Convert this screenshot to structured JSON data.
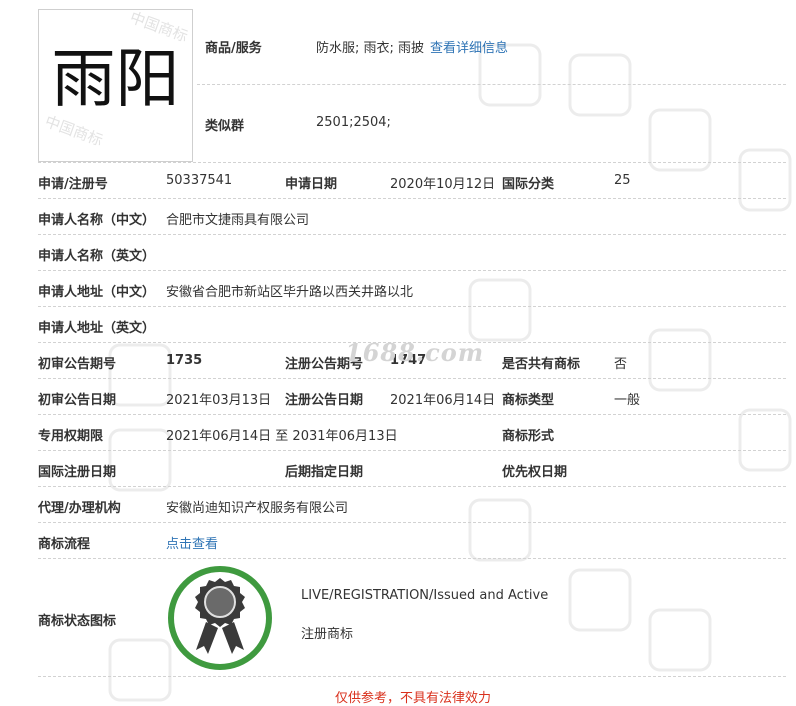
{
  "trademark": {
    "name": "雨阳",
    "goods_label": "商品/服务",
    "goods_value": "防水服; 雨衣; 雨披",
    "goods_link": "查看详细信息",
    "similar_label": "类似群",
    "similar_value": "2501;2504;"
  },
  "fields": {
    "reg_no_label": "申请/注册号",
    "reg_no": "50337541",
    "apply_date_label": "申请日期",
    "apply_date": "2020年10月12日",
    "intl_class_label": "国际分类",
    "intl_class": "25",
    "applicant_cn_label": "申请人名称（中文）",
    "applicant_cn": "合肥市文捷雨具有限公司",
    "applicant_en_label": "申请人名称（英文）",
    "address_cn_label": "申请人地址（中文）",
    "address_cn": "安徽省合肥市新站区毕升路以西关井路以北",
    "address_en_label": "申请人地址（英文）",
    "prelim_no_label": "初审公告期号",
    "prelim_no": "1735",
    "reg_pub_no_label": "注册公告期号",
    "reg_pub_no": "1747",
    "shared_label": "是否共有商标",
    "shared": "否",
    "prelim_date_label": "初审公告日期",
    "prelim_date": "2021年03月13日",
    "reg_pub_date_label": "注册公告日期",
    "reg_pub_date": "2021年06月14日",
    "tm_type_label": "商标类型",
    "tm_type": "一般",
    "exclusive_label": "专用权期限",
    "exclusive": "2021年06月14日 至 2031年06月13日",
    "tm_form_label": "商标形式",
    "intl_reg_date_label": "国际注册日期",
    "later_date_label": "后期指定日期",
    "priority_date_label": "优先权日期",
    "agent_label": "代理/办理机构",
    "agent": "安徽尚迪知识产权服务有限公司",
    "process_label": "商标流程",
    "process_link": "点击查看",
    "status_label": "商标状态图标",
    "status_en": "LIVE/REGISTRATION/Issued and Active",
    "status_cn": "注册商标"
  },
  "watermark": {
    "site": "1688.com",
    "logo_stamp": "中国商标"
  },
  "footer": {
    "disclaimer": "仅供参考，不具有法律效力"
  },
  "colors": {
    "link": "#2f74b5",
    "disclaimer": "#d9311d",
    "badge_ring": "#3f9a3f"
  },
  "icons": {
    "status_badge": "award-ribbon-icon"
  }
}
